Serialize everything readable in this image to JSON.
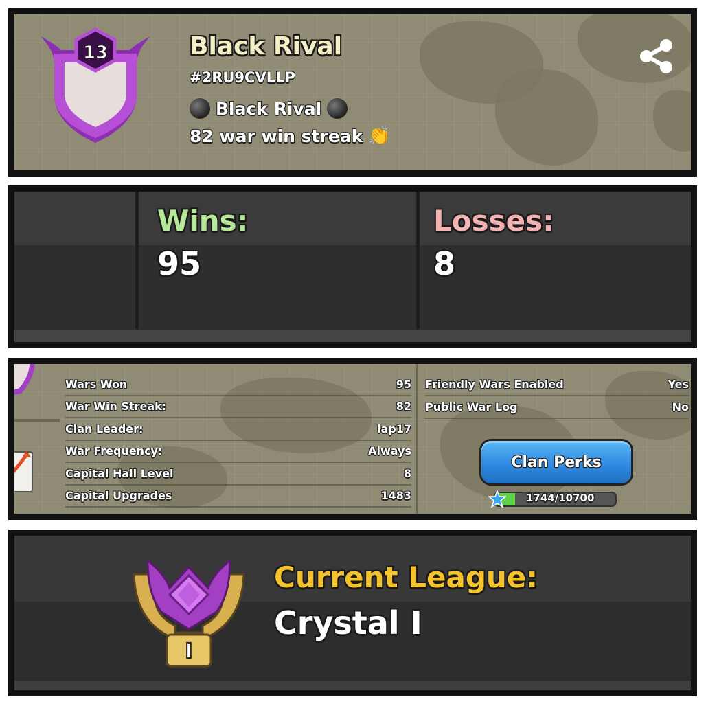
{
  "clan": {
    "level": "13",
    "name": "Black Rival",
    "tag": "#2RU9CVLLP",
    "description_line1": "Black Rival",
    "description_line2": "82 war win streak"
  },
  "record": {
    "wins_label": "Wins:",
    "wins_value": "95",
    "losses_label": "Losses:",
    "losses_value": "8"
  },
  "stats": {
    "left": [
      {
        "label": "Wars Won",
        "value": "95"
      },
      {
        "label": "War Win Streak:",
        "value": "82"
      },
      {
        "label": "Clan Leader:",
        "value": "lap17"
      },
      {
        "label": "War Frequency:",
        "value": "Always"
      },
      {
        "label": "Capital Hall Level",
        "value": "8"
      },
      {
        "label": "Capital Upgrades",
        "value": "1483"
      }
    ],
    "right": [
      {
        "label": "Friendly Wars Enabled",
        "value": "Yes"
      },
      {
        "label": "Public War Log",
        "value": "No"
      }
    ],
    "perks_button": "Clan Perks",
    "xp_text": "1744/10700",
    "xp_progress": 0.163
  },
  "league": {
    "label": "Current League:",
    "name": "Crystal I",
    "badge_numeral": "I"
  },
  "colors": {
    "wins": "#b6e89a",
    "losses": "#f3b3b3",
    "league_label": "#f6c22c",
    "badge_purple": "#a33fc2",
    "button_blue": "#2f8be0"
  },
  "icons": [
    "share-icon",
    "clan-badge-icon",
    "black-circle-emoji",
    "clapping-hands-emoji",
    "xp-star-icon",
    "league-badge-icon"
  ]
}
